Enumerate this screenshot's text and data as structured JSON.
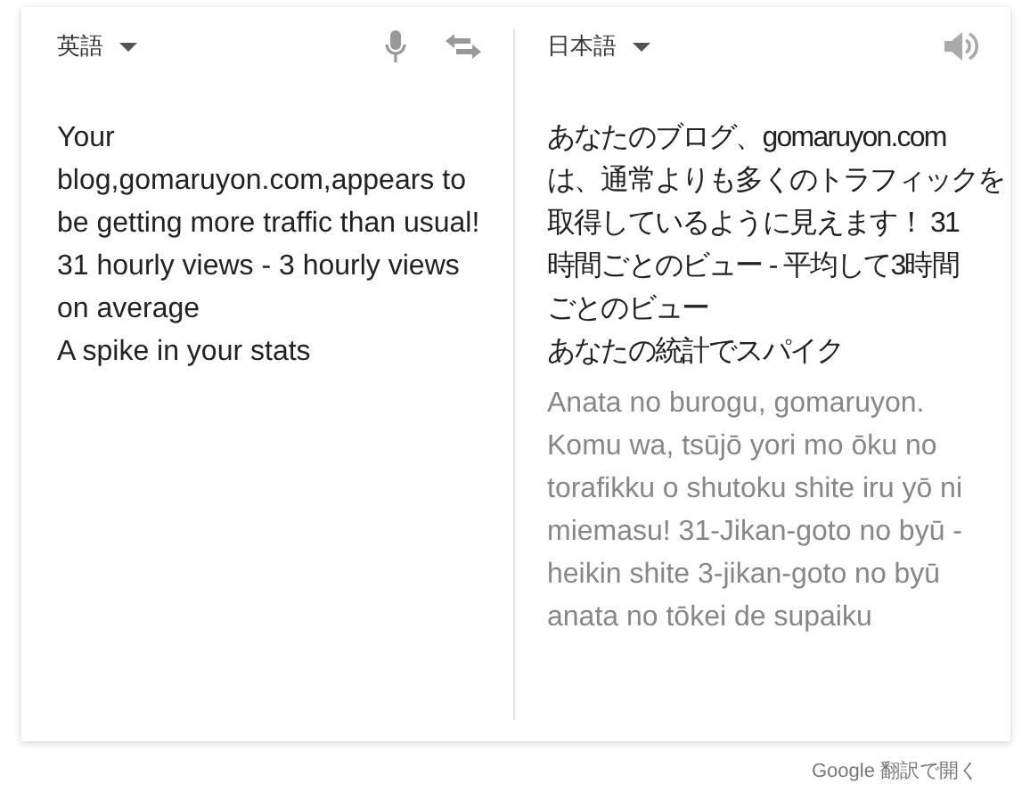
{
  "source": {
    "language": "英語",
    "lines": [
      "Your",
      "blog,gomaruyon.com,appears to",
      "be getting more traffic than usual!",
      "31 hourly views - 3 hourly views",
      "on average",
      "A spike in your stats"
    ]
  },
  "target": {
    "language": "日本語",
    "lines": [
      "あなたのブログ、gomaruyon.com",
      "は、通常よりも多くのトラフィックを",
      "取得しているように見えます！ 31",
      "時間ごとのビュー - 平均して3時間",
      "ごとのビュー",
      "あなたの統計でスパイク"
    ],
    "romanization": [
      "Anata no burogu, gomaruyon.",
      "Komu wa, tsūjō yori mo ōku no",
      "torafikku o shutoku shite iru yō ni",
      "miemasu! 31-Jikan-goto no byū -",
      "heikin shite 3-jikan-goto no byū",
      "anata no tōkei de supaiku"
    ]
  },
  "footer_link": "Google 翻訳で開く"
}
